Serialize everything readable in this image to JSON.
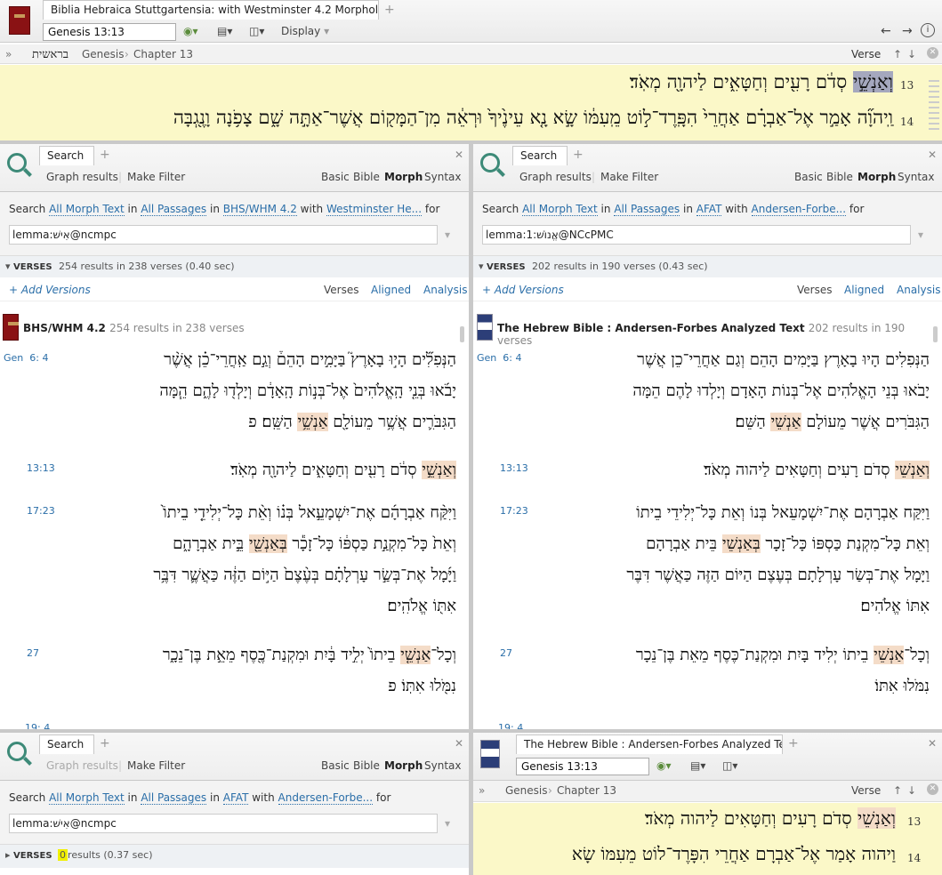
{
  "top": {
    "title": "Biblia Hebraica Stuttgartensia: with Westminster 4.2 Morphology",
    "reference": "Genesis 13:13",
    "display_label": "Display",
    "breadcrumb_hebrew": "בראשית",
    "breadcrumb_book": "Genesis",
    "breadcrumb_chapter": "Chapter 13",
    "verse_label": "Verse",
    "verses": [
      {
        "num": "13",
        "pre": "",
        "hl": "וְאַנְשֵׁ֣י",
        "post": " סְדֹ֔ם רָעִ֖ים וְחַטָּאִ֑ים לַיהוָ֖ה מְאֹֽד׃"
      },
      {
        "num": "14",
        "pre": "וַֽיהוָ֞ה אָמַ֣ר אֶל־אַבְרָ֗ם אַחֲרֵי֙ הִפָּֽרֶד־ל֣וֹט מֵֽעִמּ֔וֹ שָׂ֣א נָ֤א עֵינֶ֙יךָ֙ וּרְאֵ֔ה מִן־הַמָּק֖וֹם אֲשֶׁר־אַתָּ֣ה שָׁ֑ם צָפֹ֥נָה וָנֶ֖גְבָּה",
        "hl": "",
        "post": ""
      }
    ]
  },
  "search_left": {
    "tab": "Search",
    "graph_results": "Graph results",
    "make_filter": "Make Filter",
    "modes": [
      "Basic",
      "Bible",
      "Morph",
      "Syntax"
    ],
    "q_search": "Search",
    "q_what": "All Morph Text",
    "q_in": "in",
    "q_where": "All Passages",
    "q_in2": "in",
    "q_version": "BHS/WHM 4.2",
    "q_with": "with",
    "q_morph": "Westminster He...",
    "q_for": "for",
    "query": "lemma:אִישׁ@ncmpc",
    "verses_label": "VERSES",
    "results": "254 results in 238 verses (0.40 sec)",
    "add_versions": "+ Add Versions",
    "views": [
      "Verses",
      "Aligned",
      "Analysis"
    ],
    "res_name": "BHS/WHM 4.2",
    "res_note": "254 results in 238 verses",
    "hits": [
      {
        "ref": "Gen  6: 4",
        "lines": [
          {
            "pre": "הַנְּפִלִ֞ים הָי֣וּ בָאָרֶץ֮ בַּיָּמִ֣ים הָהֵם֒ וְגַ֣ם אַֽחֲרֵי־כֵ֗ן אֲשֶׁ֨ר",
            "hl": "",
            "post": ""
          },
          {
            "pre": "יָבֹ֜אוּ בְּנֵ֤י הָֽאֱלֹהִים֙ אֶל־בְּנ֣וֹת הָֽאָדָ֔ם וְיָלְד֖וּ לָהֶ֑ם הֵ֧מָּה",
            "hl": "",
            "post": ""
          },
          {
            "pre": "הַגִּבֹּרִ֛ים אֲשֶׁ֥ר מֵעוֹלָ֖ם ",
            "hl": "אַנְשֵׁ֥י",
            "post": " הַשֵּֽׁם׃ פ"
          }
        ]
      },
      {
        "ref": "13:13",
        "lines": [
          {
            "pre": "",
            "hl": "וְאַנְשֵׁ֣י",
            "post": " סְדֹ֔ם רָעִ֖ים וְחַטָּאִ֑ים לַיהוָ֖ה מְאֹֽד׃"
          }
        ]
      },
      {
        "ref": "17:23",
        "lines": [
          {
            "pre": "וַיִּקַּ֨ח אַבְרָהָ֜ם אֶת־יִשְׁמָעֵ֣אל בְּנ֗וֹ וְאֵ֨ת כָּל־יְלִידֵ֤י בֵיתוֹ֙",
            "hl": "",
            "post": ""
          },
          {
            "pre": "וְאֵת֙ כָּל־מִקְנַ֣ת כַּסְפּ֔וֹ כָּל־זָכָ֕ר ",
            "hl": "בְּאַנְשֵׁ֖י",
            "post": " בֵּ֣ית אַבְרָהָ֑ם"
          },
          {
            "pre": "וַיָּ֜מָל אֶת־בְּשַׂ֣ר עָרְלָתָ֗ם בְּעֶ֨צֶם֙ הַיּ֣וֹם הַזֶּ֔ה כַּאֲשֶׁ֛ר דִּבֶּ֥ר",
            "hl": "",
            "post": ""
          },
          {
            "pre": "אִתּ֖וֹ אֱלֹהִֽים׃",
            "hl": "",
            "post": ""
          }
        ]
      },
      {
        "ref": "27",
        "lines": [
          {
            "pre": "וְכָל־",
            "hl": "אַנְשֵׁ֤י",
            "post": " בֵיתוֹ֙ יְלִ֣יד בָּ֔יִת וּמִקְנַת־כֶּ֖סֶף מֵאֵ֣ת בֶּן־נֵכָ֑ר"
          },
          {
            "pre": "נִמֹּ֖לוּ אִתּֽוֹ׃ פ",
            "hl": "",
            "post": ""
          }
        ]
      }
    ],
    "cut_ref": "19: 4"
  },
  "search_right": {
    "tab": "Search",
    "graph_results": "Graph results",
    "make_filter": "Make Filter",
    "modes": [
      "Basic",
      "Bible",
      "Morph",
      "Syntax"
    ],
    "q_search": "Search",
    "q_what": "All Morph Text",
    "q_in": "in",
    "q_where": "All Passages",
    "q_in2": "in",
    "q_version": "AFAT",
    "q_with": "with",
    "q_morph": "Andersen-Forbe...",
    "q_for": "for",
    "query": "lemma:1:אֱנוֹשׁ@NCcPMC",
    "verses_label": "VERSES",
    "results": "202 results in 190 verses (0.43 sec)",
    "add_versions": "+ Add Versions",
    "views": [
      "Verses",
      "Aligned",
      "Analysis"
    ],
    "res_name": "The Hebrew Bible : Andersen-Forbes Analyzed Text",
    "res_note": "202 results in 190 verses",
    "hits": [
      {
        "ref": "Gen  6: 4",
        "lines": [
          {
            "pre": "הַנְּפִלִים הָיוּ בָאָרֶץ בַּיָּמִים הָהֵם וְגַם אַחֲרֵי־כֵן אֲשֶׁר",
            "hl": "",
            "post": ""
          },
          {
            "pre": "יָבֹאוּ בְּנֵי הָאֱלֹהִים אֶל־בְּנוֹת הָאָדָם וְיָלְדוּ לָהֶם הֵמָּה",
            "hl": "",
            "post": ""
          },
          {
            "pre": "הַגִּבֹּרִים אֲשֶׁר מֵעוֹלָם ",
            "hl": "אַנְשֵׁי",
            "post": " הַשֵּׁם׃"
          }
        ]
      },
      {
        "ref": "13:13",
        "lines": [
          {
            "pre": "",
            "hl": "וְאַנְשֵׁי",
            "post": " סְדֹם רָעִים וְחַטָּאִים לַיהוה מְאֹד׃"
          }
        ]
      },
      {
        "ref": "17:23",
        "lines": [
          {
            "pre": "וַיִּקַּח אַבְרָהָם אֶת־יִשְׁמָעֵאל בְּנוֹ וְאֵת כָּל־יְלִידֵי בֵיתוֹ",
            "hl": "",
            "post": ""
          },
          {
            "pre": "וְאֵת כָּל־מִקְנַת כַּסְפּוֹ כָּל־זָכָר ",
            "hl": "בְּאַנְשֵׁי",
            "post": " בֵּית אַבְרָהָם"
          },
          {
            "pre": "וַיָּמָל אֶת־בְּשַׂר עָרְלָתָם בְּעֶצֶם הַיּוֹם הַזֶּה כַּאֲשֶׁר דִּבֶּר",
            "hl": "",
            "post": ""
          },
          {
            "pre": "אִתּוֹ אֱלֹהִים׃",
            "hl": "",
            "post": ""
          }
        ]
      },
      {
        "ref": "27",
        "lines": [
          {
            "pre": "וְכָל־",
            "hl": "אַנְשֵׁי",
            "post": " בֵיתוֹ יְלִיד בָּיִת וּמִקְנַת־כֶּסֶף מֵאֵת בֶּן־נֵכָר"
          },
          {
            "pre": "נִמֹּלוּ אִתּוֹ׃",
            "hl": "",
            "post": ""
          }
        ]
      }
    ],
    "cut_ref": "19: 4"
  },
  "search_bottom": {
    "tab": "Search",
    "graph_results": "Graph results",
    "make_filter": "Make Filter",
    "modes": [
      "Basic",
      "Bible",
      "Morph",
      "Syntax"
    ],
    "q_search": "Search",
    "q_what": "All Morph Text",
    "q_in": "in",
    "q_where": "All Passages",
    "q_in2": "in",
    "q_version": "AFAT",
    "q_with": "with",
    "q_morph": "Andersen-Forbe...",
    "q_for": "for",
    "query": "lemma:אִישׁ@ncmpc",
    "verses_label": "VERSES",
    "count": "0",
    "results": "results (0.37 sec)"
  },
  "afat_panel": {
    "title": "The Hebrew Bible : Andersen-Forbes Analyzed Text",
    "reference": "Genesis 13:13",
    "breadcrumb_book": "Genesis",
    "breadcrumb_chapter": "Chapter 13",
    "verse_label": "Verse",
    "verses": [
      {
        "num": "13",
        "pre": "",
        "hl": "וְאַנְשֵׁי",
        "post": " סְדֹם רָעִים וְחַטָּאִים לַיהוה מְאֹד׃"
      },
      {
        "num": "14",
        "pre": "וַיהוה אָמַר אֶל־אַבְרָם אַחֲרֵי הִפָּרֶד־לוֹט מֵעִמּוֹ שָׂא",
        "hl": "",
        "post": ""
      }
    ]
  }
}
